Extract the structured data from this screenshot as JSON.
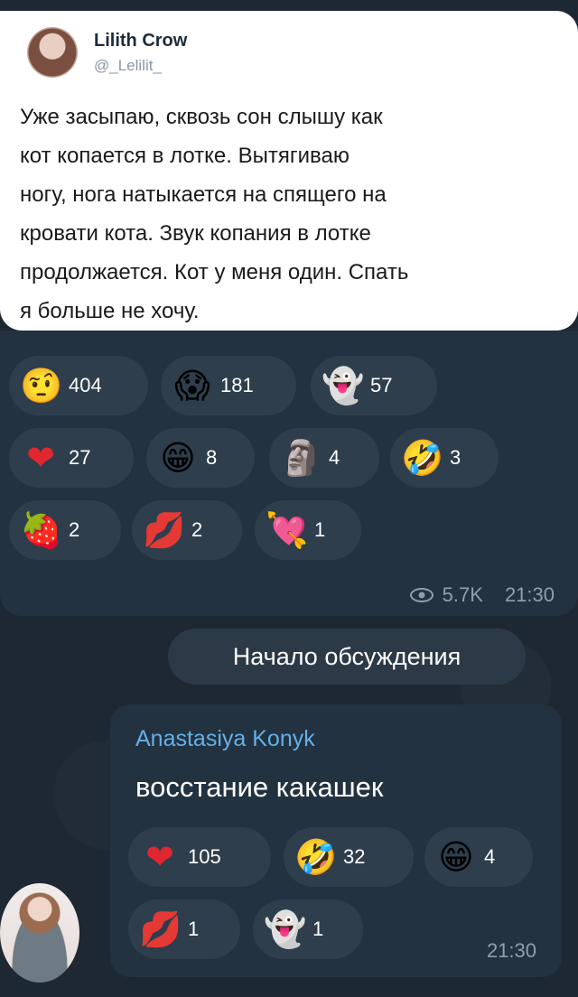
{
  "tweet": {
    "name": "Lilith Crow",
    "handle": "@_Lelilit_",
    "lines": [
      "Уже засыпаю, сквозь сон слышу как",
      "кот копается в лотке. Вытягиваю",
      "ногу, нога натыкается на спящего на",
      "кровати кота. Звук копания в лотке",
      "продолжается. Кот у меня один. Спать",
      "я больше не хочу."
    ]
  },
  "post_reactions": [
    {
      "icon": "face-with-raised-eyebrow-emoji",
      "glyph": "🤨",
      "count": "404"
    },
    {
      "icon": "screaming-face-emoji",
      "glyph": "😱",
      "count": "181"
    },
    {
      "icon": "ghost-emoji",
      "glyph": "👻",
      "count": "57"
    },
    {
      "icon": "red-heart-emoji",
      "glyph": "❤",
      "count": "27"
    },
    {
      "icon": "grinning-face-emoji",
      "glyph": "😁",
      "count": "8"
    },
    {
      "icon": "moai-emoji",
      "glyph": "🗿",
      "count": "4"
    },
    {
      "icon": "rofl-emoji",
      "glyph": "🤣",
      "count": "3"
    },
    {
      "icon": "strawberry-emoji",
      "glyph": "🍓",
      "count": "2"
    },
    {
      "icon": "kiss-mark-emoji",
      "glyph": "💋",
      "count": "2"
    },
    {
      "icon": "heart-with-arrow-emoji",
      "glyph": "💘",
      "count": "1"
    }
  ],
  "post_meta": {
    "views": "5.7K",
    "time": "21:30"
  },
  "discussion_label": "Начало обсуждения",
  "comment": {
    "author": "Anastasiya Konyk",
    "text": "восстание какашек",
    "time": "21:30",
    "reactions": [
      {
        "icon": "red-heart-emoji",
        "glyph": "❤",
        "count": "105"
      },
      {
        "icon": "rofl-emoji",
        "glyph": "🤣",
        "count": "32"
      },
      {
        "icon": "grinning-face-emoji",
        "glyph": "😁",
        "count": "4"
      },
      {
        "icon": "kiss-mark-emoji",
        "glyph": "💋",
        "count": "1"
      },
      {
        "icon": "ghost-emoji",
        "glyph": "👻",
        "count": "1"
      }
    ]
  },
  "colors": {
    "background": "#1d2833",
    "bubble": "#233240",
    "reaction_pill": "#2e3e4d",
    "accent_name": "#64b0e8",
    "meta_text": "#8da0b0"
  }
}
